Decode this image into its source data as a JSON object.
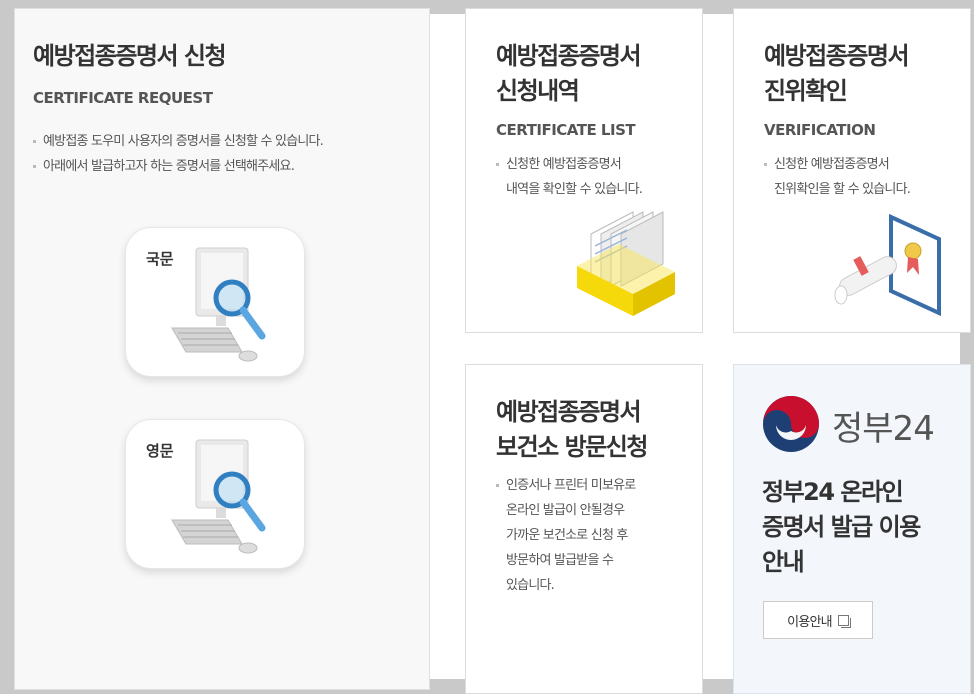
{
  "request": {
    "title": "예방접종증명서 신청",
    "subtitle": "CERTIFICATE REQUEST",
    "desc": [
      "예방접종 도우미 사용자의 증명서를 신청할 수 있습니다.",
      "아래에서 발급하고자 하는 증명서를 선택해주세요."
    ],
    "korean_label": "국문",
    "english_label": "영문"
  },
  "list": {
    "title_line1": "예방접종증명서",
    "title_line2": "신청내역",
    "subtitle": "CERTIFICATE LIST",
    "desc_line1": "신청한 예방접종증명서",
    "desc_line2": "내역을 확인할 수 있습니다."
  },
  "verify": {
    "title_line1": "예방접종증명서",
    "title_line2": "진위확인",
    "subtitle": "VERIFICATION",
    "desc_line1": "신청한 예방접종증명서",
    "desc_line2": "진위확인을 할 수 있습니다."
  },
  "visit": {
    "title_line1": "예방접종증명서",
    "title_line2": "보건소 방문신청",
    "desc_lines": [
      "인증서나 프린터 미보유로",
      "온라인 발급이 안될경우",
      "가까운 보건소로 신청 후",
      "방문하여 발급받을 수",
      "있습니다."
    ]
  },
  "gov24": {
    "brand": "정부24",
    "title_line1": "정부24 온라인",
    "title_line2": "증명서 발급 이용",
    "title_line3": "안내",
    "button_label": "이용안내"
  },
  "colors": {
    "accent_red": "#c8102e",
    "accent_blue": "#1d3f73",
    "folder_yellow": "#f5d90a"
  }
}
